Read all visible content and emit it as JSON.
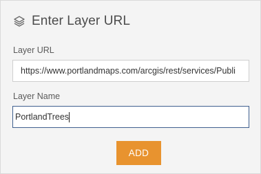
{
  "header": {
    "icon": "layers-icon",
    "title": "Enter Layer URL"
  },
  "form": {
    "url_label": "Layer URL",
    "url_value": "https://www.portlandmaps.com/arcgis/rest/services/Publi",
    "name_label": "Layer Name",
    "name_value": "PortlandTrees",
    "add_label": "ADD"
  },
  "colors": {
    "panel_bg": "#f4f4f4",
    "accent_button": "#e8932f",
    "focused_border": "#3f5f8e"
  }
}
